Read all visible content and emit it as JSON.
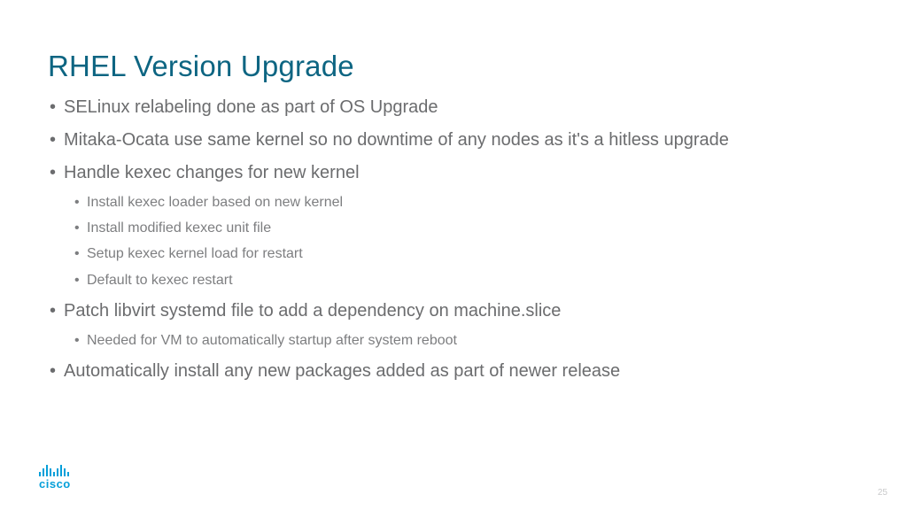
{
  "title": "RHEL Version Upgrade",
  "bullets": [
    {
      "text": "SELinux relabeling done as part of OS Upgrade",
      "children": []
    },
    {
      "text": "Mitaka-Ocata use same kernel so no downtime of any nodes as it's a hitless upgrade",
      "children": []
    },
    {
      "text": "Handle kexec changes for new kernel",
      "children": [
        "Install kexec loader based on new kernel",
        "Install modified kexec unit file",
        "Setup kexec kernel load for restart",
        "Default to kexec restart"
      ]
    },
    {
      "text": "Patch libvirt systemd file to add a dependency on machine.slice",
      "children": [
        "Needed for VM to automatically startup after system reboot"
      ]
    },
    {
      "text": "Automatically install any new packages added as part of newer release",
      "children": []
    }
  ],
  "brand": "cisco",
  "page_number": "25"
}
